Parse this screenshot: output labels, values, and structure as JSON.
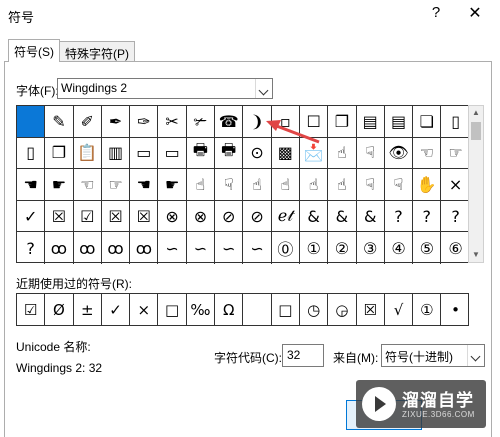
{
  "window": {
    "title": "符号",
    "help": "?",
    "close": "✕"
  },
  "tabs": [
    {
      "label": "符号(S)"
    },
    {
      "label": "特殊字符(P)"
    }
  ],
  "font": {
    "label": "字体(F):",
    "value": "Wingdings 2"
  },
  "symbol_rows": [
    [
      "",
      "✎",
      "✐",
      "✒",
      "✑",
      "✂",
      "✃",
      "☎",
      "❩",
      "▫",
      "☐",
      "❐",
      "▤",
      "▤",
      "❏",
      "▯"
    ],
    [
      "▯",
      "❐",
      "📋",
      "▥",
      "▭",
      "▭",
      "🖶",
      "🖶",
      "⊙",
      "▩",
      "📩",
      "☝",
      "☟",
      "👁",
      "☜",
      "☞"
    ],
    [
      "☚",
      "☛",
      "☜",
      "☞",
      "☚",
      "☛",
      "☝",
      "☟",
      "☝",
      "☝",
      "☝",
      "☝",
      "☟",
      "☟",
      "✋",
      "×"
    ],
    [
      "✓",
      "☒",
      "☑",
      "☒",
      "☒",
      "⊗",
      "⊗",
      "⊘",
      "⊘",
      "ℯ𝓉",
      "&",
      "&",
      "&",
      "?",
      "?",
      "?"
    ],
    [
      "?",
      "ꝏ",
      "ꝏ",
      "ꝏ",
      "ꝏ",
      "∽",
      "∽",
      "∽",
      "∽",
      "⓪",
      "①",
      "②",
      "③",
      "④",
      "⑤",
      "⑥"
    ]
  ],
  "recent": {
    "label": "近期使用过的符号(R):",
    "symbols": [
      "☑",
      "Ø",
      "±",
      "✓",
      "×",
      "□",
      "‰",
      "Ω",
      "",
      "□",
      "◷",
      "◶",
      "☒",
      "√",
      "①",
      "•"
    ]
  },
  "unicode_name": {
    "label": "Unicode 名称:",
    "value": "Wingdings 2: 32"
  },
  "char_code": {
    "label": "字符代码(C):",
    "value": "32"
  },
  "from": {
    "label": "来自(M):",
    "value": "符号(十进制)"
  },
  "watermark": {
    "title": "溜溜自学",
    "subtitle": "ZIXUE.3D66.COM"
  },
  "colors": {
    "selection": "#0b78d7",
    "annotation_arrow": "#e04646"
  }
}
